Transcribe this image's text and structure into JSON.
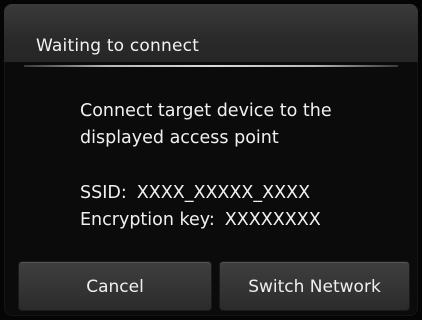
{
  "dialog": {
    "title": "Waiting to connect",
    "message_line1": "Connect target device to the",
    "message_line2": "displayed access point",
    "ssid_label": "SSID:",
    "ssid_value": "XXXX_XXXXX_XXXX",
    "key_label": "Encryption key:",
    "key_value": "XXXXXXXX"
  },
  "buttons": {
    "cancel_label": "Cancel",
    "switch_label": "Switch Network"
  }
}
